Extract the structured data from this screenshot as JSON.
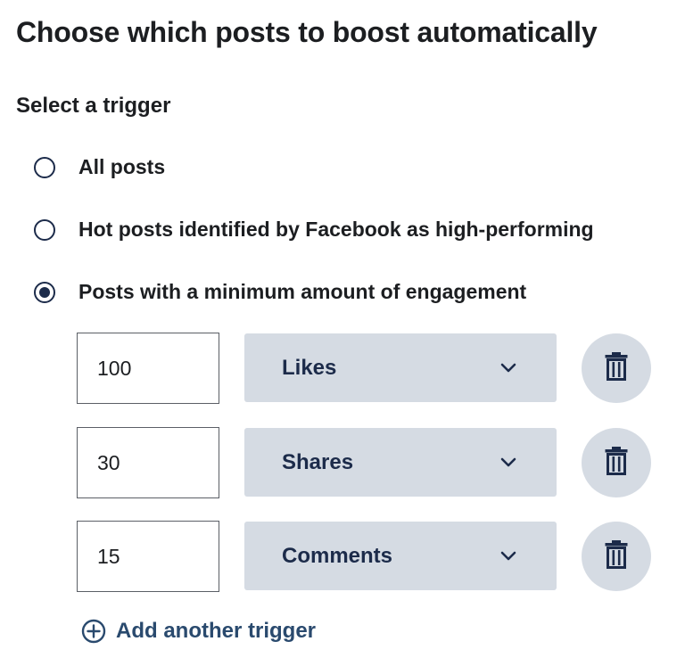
{
  "header": {
    "title": "Choose which posts to boost automatically"
  },
  "trigger_section": {
    "label": "Select a trigger",
    "options": [
      {
        "label": "All posts",
        "selected": false
      },
      {
        "label": "Hot posts identified by Facebook as high-performing",
        "selected": false
      },
      {
        "label": "Posts with a minimum amount of engagement",
        "selected": true
      }
    ]
  },
  "engagement_triggers": [
    {
      "value": "100",
      "metric": "Likes"
    },
    {
      "value": "30",
      "metric": "Shares"
    },
    {
      "value": "15",
      "metric": "Comments"
    }
  ],
  "add_trigger": {
    "label": "Add another trigger"
  },
  "icons": {
    "radio": "radio-icon",
    "chevron": "chevron-down-icon",
    "delete": "trash-icon",
    "add": "plus-circle-icon"
  },
  "colors": {
    "accent_dark": "#1c2b4a",
    "select_bg": "#d5dbe3",
    "link": "#2a4a6e",
    "text": "#1c1e21"
  }
}
